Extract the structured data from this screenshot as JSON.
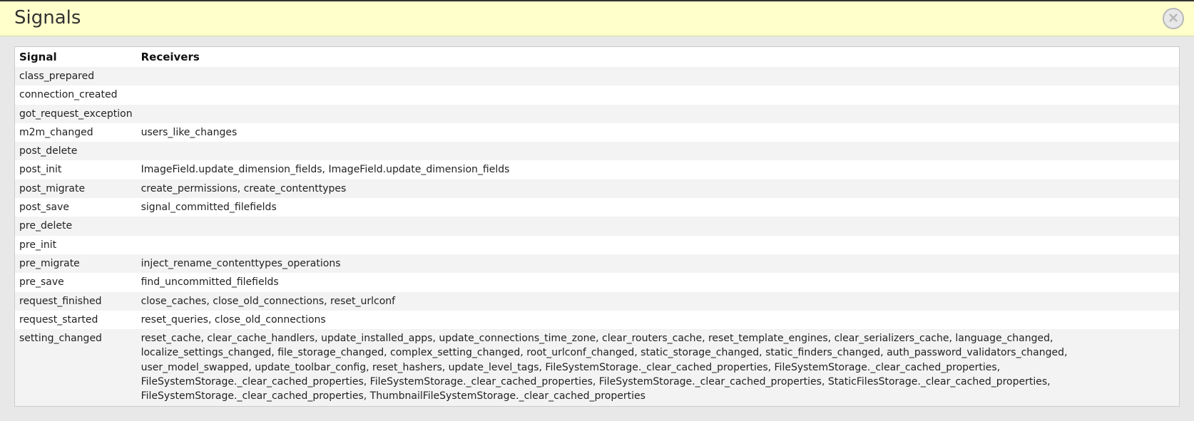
{
  "header": {
    "title": "Signals"
  },
  "table": {
    "columns": {
      "signal": "Signal",
      "receivers": "Receivers"
    },
    "rows": [
      {
        "signal": "class_prepared",
        "receivers": ""
      },
      {
        "signal": "connection_created",
        "receivers": ""
      },
      {
        "signal": "got_request_exception",
        "receivers": ""
      },
      {
        "signal": "m2m_changed",
        "receivers": "users_like_changes"
      },
      {
        "signal": "post_delete",
        "receivers": ""
      },
      {
        "signal": "post_init",
        "receivers": "ImageField.update_dimension_fields, ImageField.update_dimension_fields"
      },
      {
        "signal": "post_migrate",
        "receivers": "create_permissions, create_contenttypes"
      },
      {
        "signal": "post_save",
        "receivers": "signal_committed_filefields"
      },
      {
        "signal": "pre_delete",
        "receivers": ""
      },
      {
        "signal": "pre_init",
        "receivers": ""
      },
      {
        "signal": "pre_migrate",
        "receivers": "inject_rename_contenttypes_operations"
      },
      {
        "signal": "pre_save",
        "receivers": "find_uncommitted_filefields"
      },
      {
        "signal": "request_finished",
        "receivers": "close_caches, close_old_connections, reset_urlconf"
      },
      {
        "signal": "request_started",
        "receivers": "reset_queries, close_old_connections"
      },
      {
        "signal": "setting_changed",
        "receivers": "reset_cache, clear_cache_handlers, update_installed_apps, update_connections_time_zone, clear_routers_cache, reset_template_engines, clear_serializers_cache, language_changed, localize_settings_changed, file_storage_changed, complex_setting_changed, root_urlconf_changed, static_storage_changed, static_finders_changed, auth_password_validators_changed, user_model_swapped, update_toolbar_config, reset_hashers, update_level_tags, FileSystemStorage._clear_cached_properties, FileSystemStorage._clear_cached_properties, FileSystemStorage._clear_cached_properties, FileSystemStorage._clear_cached_properties, FileSystemStorage._clear_cached_properties, StaticFilesStorage._clear_cached_properties, FileSystemStorage._clear_cached_properties, ThumbnailFileSystemStorage._clear_cached_properties"
      }
    ]
  }
}
